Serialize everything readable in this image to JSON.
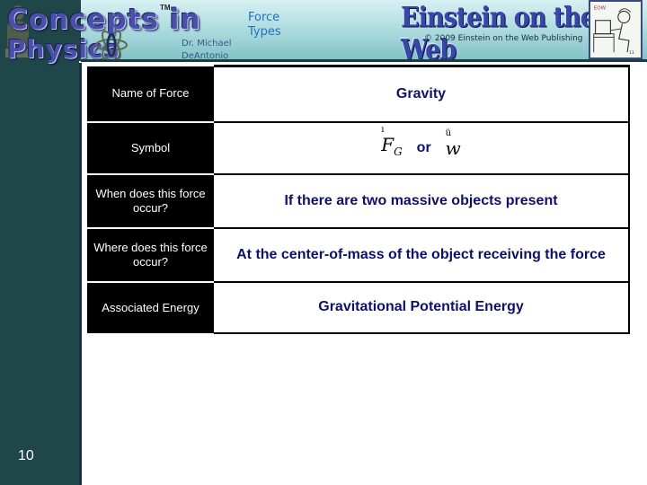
{
  "header": {
    "logo_line1": "Concepts in",
    "logo_line2": "Physics",
    "trademark": "TM",
    "author_line1": "Dr. Michael",
    "author_line2": "DeAntonio",
    "topic_line1": "Force",
    "topic_line2": "Types",
    "publisher_logo": "Einstein on the Web",
    "copyright": "© 2009 Einstein on the Web Publishing"
  },
  "table": {
    "rows": [
      {
        "label": "Name of Force",
        "value": "Gravity"
      },
      {
        "label": "Symbol",
        "symbol_primary": "F",
        "symbol_primary_subscript": "G",
        "symbol_connector": "or",
        "symbol_alt": "w"
      },
      {
        "label": "When does this force occur?",
        "value": "If there are two massive objects present"
      },
      {
        "label": "Where does this force occur?",
        "value": "At the center-of-mass of the object receiving the force"
      },
      {
        "label": "Associated Energy",
        "value": "Gravitational Potential Energy"
      }
    ]
  },
  "footer": {
    "page_number": "10"
  },
  "colors": {
    "sidebar": "#1f4648",
    "value_text": "#10106a",
    "label_bg": "#000000",
    "topic_text": "#2070c0"
  }
}
